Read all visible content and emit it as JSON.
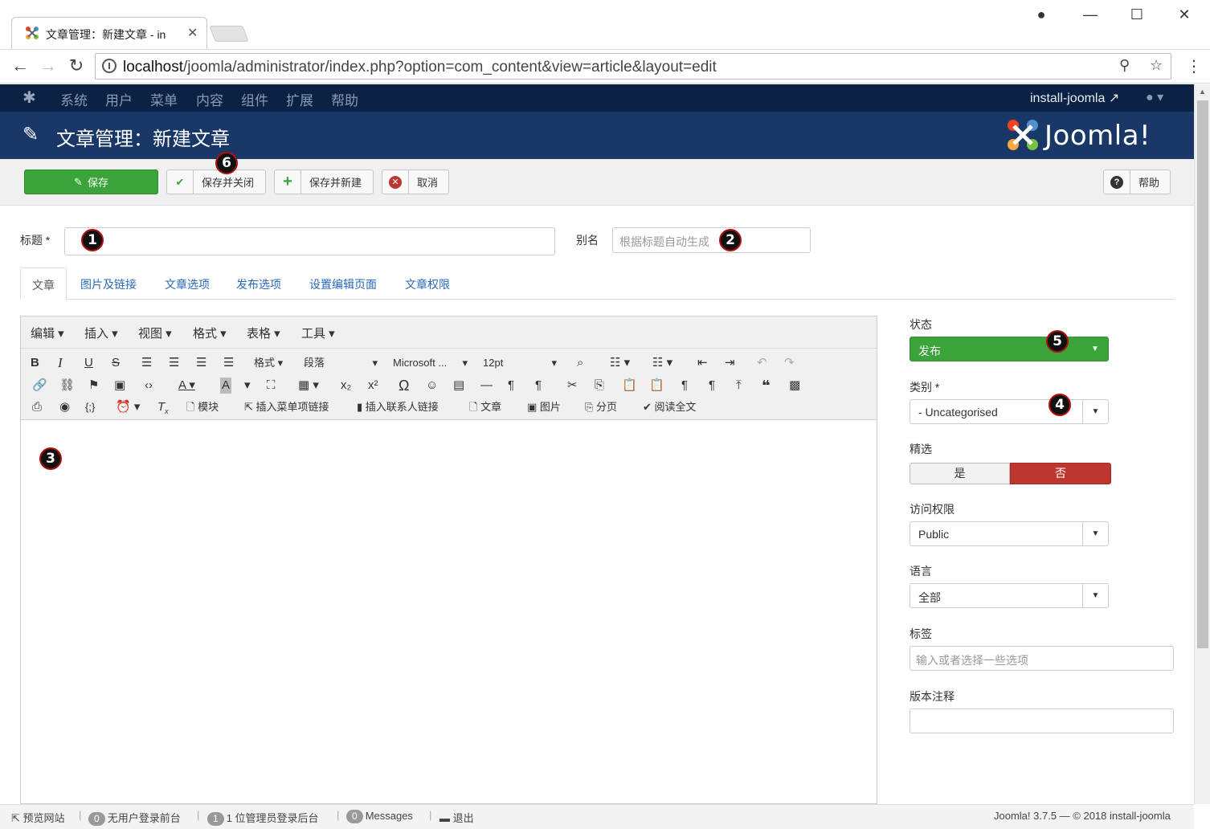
{
  "browser": {
    "tab_title": "文章管理：新建文章 - in",
    "url_host": "localhost",
    "url_path": "/joomla/administrator/index.php?option=com_content&view=article&layout=edit"
  },
  "navbar": {
    "menu": [
      "系统",
      "用户",
      "菜单",
      "内容",
      "组件",
      "扩展",
      "帮助"
    ],
    "site_name": "install-joomla"
  },
  "header": {
    "title": "文章管理：新建文章",
    "logo_text": "Joomla!"
  },
  "toolbar": {
    "save": "保存",
    "save_close": "保存并关闭",
    "save_new": "保存并新建",
    "cancel": "取消",
    "help": "帮助"
  },
  "form": {
    "title_label": "标题 *",
    "title_value": "",
    "alias_label": "别名",
    "alias_placeholder": "根据标题自动生成"
  },
  "tabs": [
    "文章",
    "图片及链接",
    "文章选项",
    "发布选项",
    "设置编辑页面",
    "文章权限"
  ],
  "editor": {
    "menus": [
      "编辑",
      "插入",
      "视图",
      "格式",
      "表格",
      "工具"
    ],
    "format_select": "格式",
    "block_select": "段落",
    "font_select": "Microsoft ...",
    "size_select": "12pt",
    "buttons": {
      "module": "模块",
      "menu_link": "插入菜单项链接",
      "contact_link": "插入联系人链接",
      "article": "文章",
      "image": "图片",
      "pagebreak": "分页",
      "readmore": "阅读全文"
    }
  },
  "sidebar": {
    "status_label": "状态",
    "status_value": "发布",
    "category_label": "类别 *",
    "category_value": "- Uncategorised",
    "featured_label": "精选",
    "featured_yes": "是",
    "featured_no": "否",
    "access_label": "访问权限",
    "access_value": "Public",
    "language_label": "语言",
    "language_value": "全部",
    "tags_label": "标签",
    "tags_placeholder": "输入或者选择一些选项",
    "version_note_label": "版本注释"
  },
  "markers": [
    "1",
    "2",
    "3",
    "4",
    "5",
    "6"
  ],
  "footer": {
    "preview": "预览网站",
    "visitors_count": "0",
    "visitors_text": "无用户登录前台",
    "admins_count": "1",
    "admins_text": "1 位管理员登录后台",
    "messages_count": "0",
    "messages_text": "Messages",
    "logout": "退出",
    "copyright": "Joomla! 3.7.5 — © 2018 install-joomla"
  },
  "colors": {
    "navbar": "#0b2244",
    "header": "#1a3867",
    "save_green": "#3aa43a",
    "no_red": "#bd362f",
    "link_blue": "#2a69b8"
  }
}
